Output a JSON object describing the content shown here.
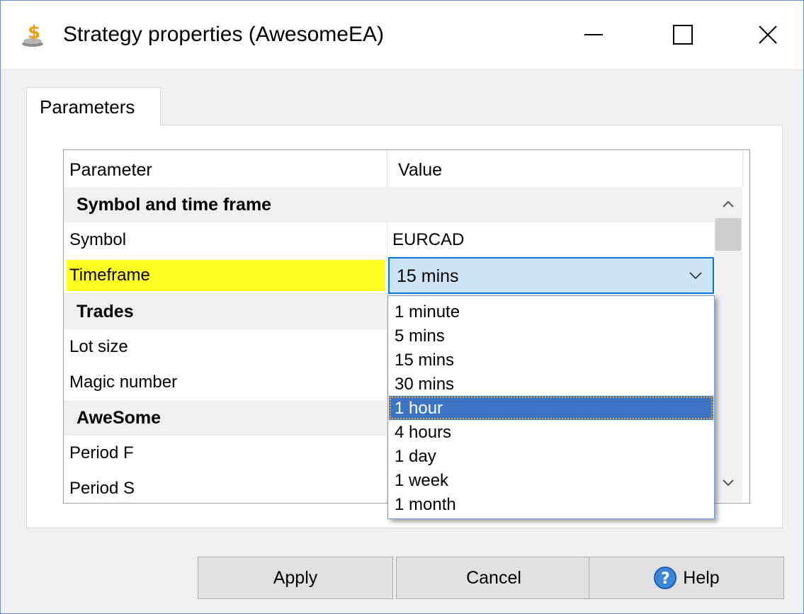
{
  "window": {
    "title": "Strategy properties (AwesomeEA)",
    "icon": "strategy-dollar-icon",
    "controls": [
      "minimize-icon",
      "maximize-icon",
      "close-icon"
    ]
  },
  "tabs": [
    {
      "label": "Parameters",
      "active": true
    }
  ],
  "grid": {
    "headers": {
      "parameter": "Parameter",
      "value": "Value"
    },
    "rows": [
      {
        "type": "section",
        "label": "Symbol and time frame"
      },
      {
        "type": "param",
        "label": "Symbol",
        "value": "EURCAD"
      },
      {
        "type": "param",
        "label": "Timeframe",
        "value": "15 mins",
        "highlighted": true,
        "editing": true
      },
      {
        "type": "section",
        "label": "Trades"
      },
      {
        "type": "param",
        "label": "Lot size",
        "value": ""
      },
      {
        "type": "param",
        "label": "Magic number",
        "value": ""
      },
      {
        "type": "section",
        "label": "AweSome"
      },
      {
        "type": "param",
        "label": "Period F",
        "value": ""
      },
      {
        "type": "param",
        "label": "Period S",
        "value": ""
      }
    ]
  },
  "timeframe_combo": {
    "value": "15 mins",
    "options": [
      "1 minute",
      "5 mins",
      "15 mins",
      "30 mins",
      "1 hour",
      "4 hours",
      "1 day",
      "1 week",
      "1 month"
    ],
    "hovered_option": "1 hour"
  },
  "buttons": {
    "apply": "Apply",
    "cancel": "Cancel",
    "help": "Help"
  },
  "colors": {
    "highlight": "#ffff24",
    "selection": "#3d75c5",
    "combo_bg": "#cce4f7",
    "combo_border": "#0078d7"
  }
}
